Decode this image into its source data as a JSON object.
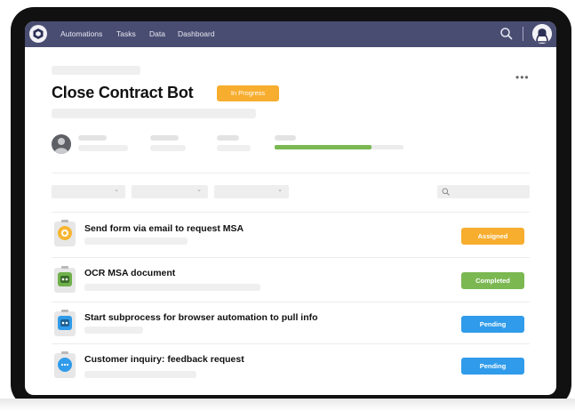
{
  "nav": {
    "items": [
      "Automations",
      "Tasks",
      "Data",
      "Dashboard"
    ]
  },
  "icons": {
    "logo": "logo-icon",
    "search": "search-icon",
    "avatar": "avatar-icon",
    "more": "more-icon",
    "chevron": "chevron-down-icon"
  },
  "header": {
    "title": "Close Contract Bot",
    "status": "In Progress",
    "more_label": "•••"
  },
  "progress": {
    "value": 0.75
  },
  "filters": {
    "chevron_glyph": "⌄"
  },
  "tasks": [
    {
      "title": "Send form via email to request MSA",
      "status": "Assigned",
      "status_color": "#f7ad2e",
      "icon": "form-icon"
    },
    {
      "title": "OCR MSA document",
      "status": "Completed",
      "status_color": "#7bb851",
      "icon": "robot-icon"
    },
    {
      "title": "Start subprocess for browser automation to pull info",
      "status": "Pending",
      "status_color": "#2f9bea",
      "icon": "robot-icon"
    },
    {
      "title": "Customer inquiry: feedback request",
      "status": "Pending",
      "status_color": "#2f9bea",
      "icon": "chat-icon"
    }
  ],
  "colors": {
    "topbar": "#4a4d72",
    "in_progress": "#f7ad2e",
    "assigned": "#f7ad2e",
    "completed": "#7bb851",
    "pending": "#2f9bea"
  }
}
